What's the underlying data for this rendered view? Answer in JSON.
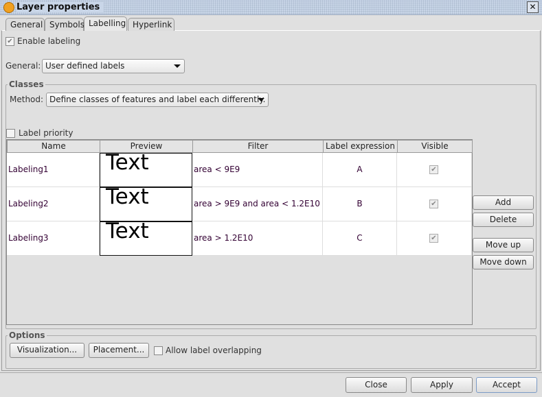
{
  "window": {
    "title": "Layer properties",
    "close": "✕"
  },
  "tabs": [
    {
      "label": "General"
    },
    {
      "label": "Symbols"
    },
    {
      "label": "Labelling",
      "selected": true
    },
    {
      "label": "Hyperlink"
    }
  ],
  "enable_labeling": {
    "label": "Enable labeling",
    "checked": true
  },
  "general": {
    "label": "General:",
    "value": "User defined labels"
  },
  "classes": {
    "title": "Classes",
    "method_label": "Method:",
    "method_value": "Define classes of features and label each differently.",
    "label_priority": {
      "label": "Label priority",
      "checked": false
    },
    "columns": [
      "Name",
      "Preview",
      "Filter",
      "Label expression",
      "Visible"
    ],
    "rows": [
      {
        "name": "Labeling1",
        "preview": "Text",
        "filter": "area < 9E9",
        "expression": "A",
        "visible": true
      },
      {
        "name": "Labeling2",
        "preview": "Text",
        "filter": "area > 9E9 and area < 1.2E10",
        "expression": "B",
        "visible": true
      },
      {
        "name": "Labeling3",
        "preview": "Text",
        "filter": "area > 1.2E10",
        "expression": "C",
        "visible": true
      }
    ],
    "buttons": {
      "add": "Add",
      "delete": "Delete",
      "move_up": "Move up",
      "move_down": "Move down"
    }
  },
  "options": {
    "title": "Options",
    "visualization": "Visualization...",
    "placement": "Placement...",
    "allow_overlap": {
      "label": "Allow label overlapping",
      "checked": false
    }
  },
  "footer": {
    "close": "Close",
    "apply": "Apply",
    "accept": "Accept"
  },
  "check_glyph": "✔"
}
